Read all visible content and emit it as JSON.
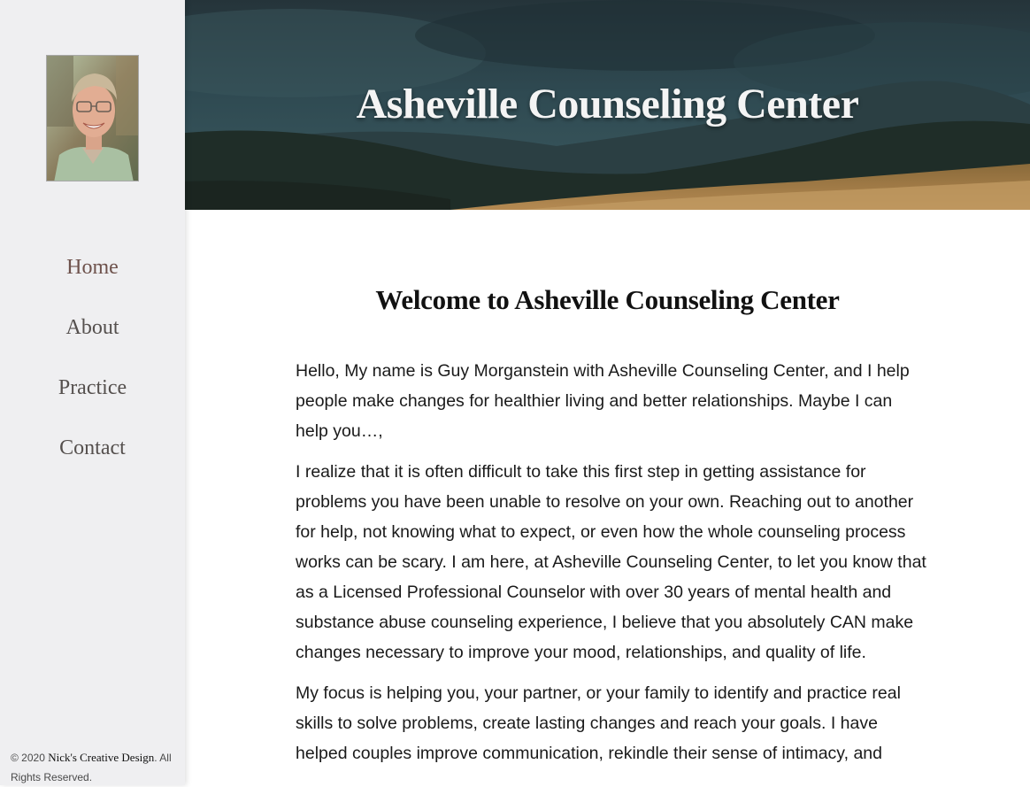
{
  "sidebar": {
    "avatar_alt": "Guy Morganstein",
    "nav": [
      {
        "label": "Home"
      },
      {
        "label": "About"
      },
      {
        "label": "Practice"
      },
      {
        "label": "Contact"
      }
    ],
    "footer": {
      "prefix": "© 2020 ",
      "brand": "Nick's Creative Design",
      "suffix": ". All Rights Reserved."
    }
  },
  "hero": {
    "title": "Asheville Counseling Center"
  },
  "main": {
    "heading": "Welcome to Asheville Counseling Center",
    "paragraphs": [
      "Hello, My name is Guy Morganstein with Asheville Counseling Center, and I help people make changes for healthier living and better relationships. Maybe I can help you…,",
      "I realize that it is often difficult to take this first step in getting assistance for problems you have been unable to resolve on your own. Reaching out to another for help, not knowing what to expect, or even how the whole counseling process works can be scary. I am here, at Asheville Counseling Center, to let you know that as a Licensed Professional Counselor with over 30 years of mental health and substance abuse counseling experience, I believe that you absolutely CAN make changes necessary to improve your mood, relationships, and quality of life.",
      "My focus is helping you, your partner, or your family to identify and practice real skills to solve problems, create lasting changes and reach your goals. I have helped couples improve communication, rekindle their sense of intimacy, and"
    ]
  },
  "colors": {
    "sidebar_bg": "#efeff1",
    "nav_text": "#55504e",
    "nav_active": "#6e524c",
    "hero_sky": "#20353b"
  }
}
